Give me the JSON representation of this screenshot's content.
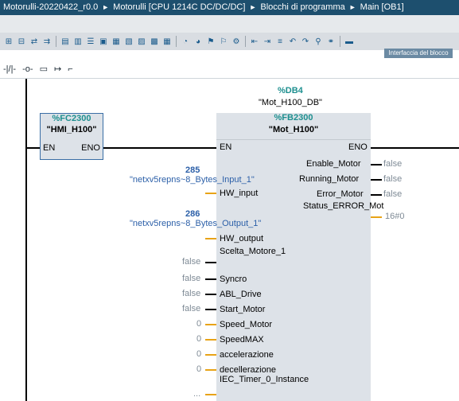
{
  "breadcrumb": {
    "project": "Motorulli-20220422_r0.0",
    "device": "Motorulli [CPU 1214C DC/DC/DC]",
    "folder": "Blocchi di programma",
    "block": "Main [OB1]",
    "separator": "►"
  },
  "toolbar": {
    "interface_tab": "Interfaccia del blocco"
  },
  "lad_toolbar": {
    "items": [
      "-|/|-",
      "-o-",
      "▭",
      "↦",
      "⌐"
    ]
  },
  "fc_block": {
    "address": "%FC2300",
    "name": "\"HMI_H100\"",
    "en": "EN",
    "eno": "ENO"
  },
  "fb_block": {
    "db_address": "%DB4",
    "db_name": "\"Mot_H100_DB\"",
    "address": "%FB2300",
    "name": "\"Mot_H100\"",
    "en": "EN",
    "eno": "ENO",
    "inputs": [
      {
        "pin": "HW_input",
        "value_num": "285",
        "value_text": "\"netxv5repns~8_Bytes_Input_1\""
      },
      {
        "pin": "HW_output",
        "value_num": "286",
        "value_text": "\"netxv5repns~8_Bytes_Output_1\""
      },
      {
        "pin": "Scelta_Motore_1",
        "value": "false"
      },
      {
        "pin": "Syncro",
        "value": "false"
      },
      {
        "pin": "ABL_Drive",
        "value": "false"
      },
      {
        "pin": "Start_Motor",
        "value": "false"
      },
      {
        "pin": "Speed_Motor",
        "value": "0"
      },
      {
        "pin": "SpeedMAX",
        "value": "0"
      },
      {
        "pin": "accelerazione",
        "value": "0"
      },
      {
        "pin": "decellerazione",
        "value": "0"
      },
      {
        "pin": "IEC_Timer_0_Instance",
        "value": "..."
      }
    ],
    "outputs": [
      {
        "pin": "Enable_Motor",
        "value": "false"
      },
      {
        "pin": "Running_Motor",
        "value": "false"
      },
      {
        "pin": "Error_Motor",
        "value": "false"
      },
      {
        "pin": "Status_ERROR_Mot",
        "value": "16#0"
      }
    ]
  }
}
